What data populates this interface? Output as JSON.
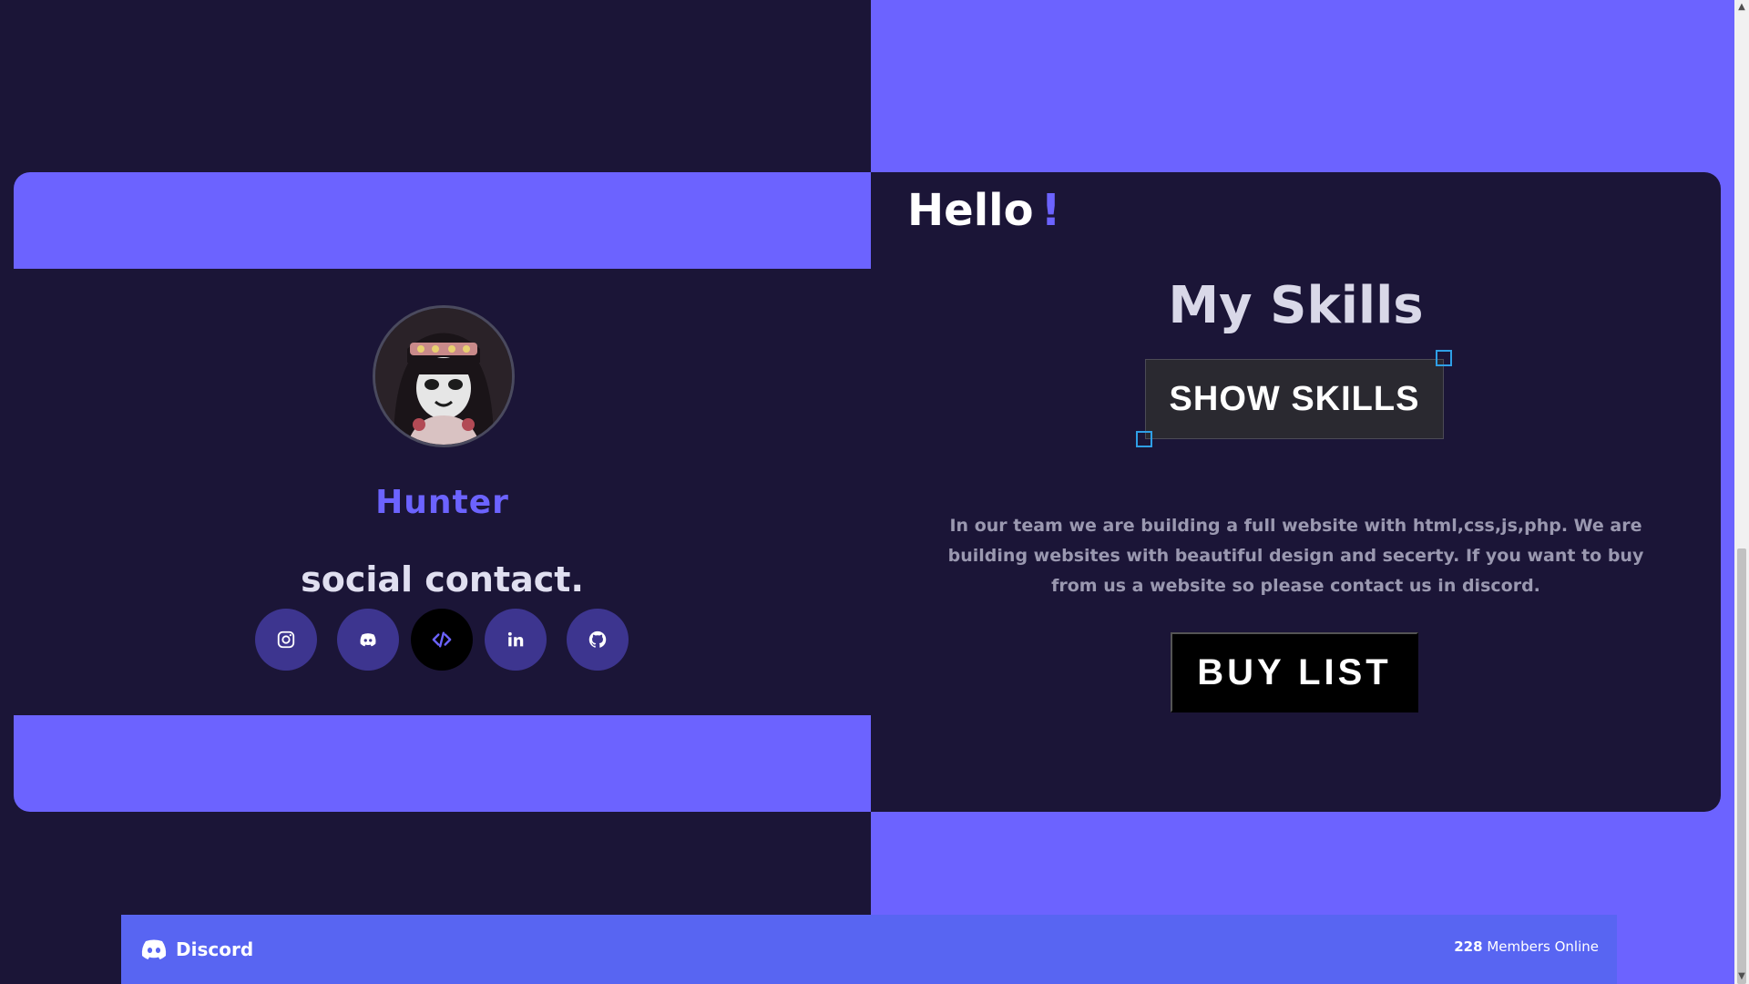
{
  "colors": {
    "accent": "#6c63ff",
    "dark": "#1b1537",
    "discord": "#5865f2"
  },
  "profile": {
    "name": "Hunter",
    "avatar_alt": "avatar",
    "social_title": "social contact."
  },
  "social": [
    {
      "icon": "instagram-icon",
      "active": false
    },
    {
      "icon": "discord-icon",
      "active": false
    },
    {
      "icon": "code-icon",
      "active": true
    },
    {
      "icon": "linkedin-icon",
      "active": false
    },
    {
      "icon": "github-icon",
      "active": false
    }
  ],
  "hero": {
    "hello": "Hello",
    "bang": "!",
    "skills_title": "My Skills",
    "show_skills_label": "SHOW SKILLS",
    "description": "In our team we are building a full website with html,css,js,php. We are building websites with beautiful design and secerty. If you want to buy from us a website so please contact us in discord.",
    "buy_list_label": "BUY LIST"
  },
  "discord_widget": {
    "brand": "Discord",
    "members_count": "228",
    "members_label": " Members Online"
  }
}
